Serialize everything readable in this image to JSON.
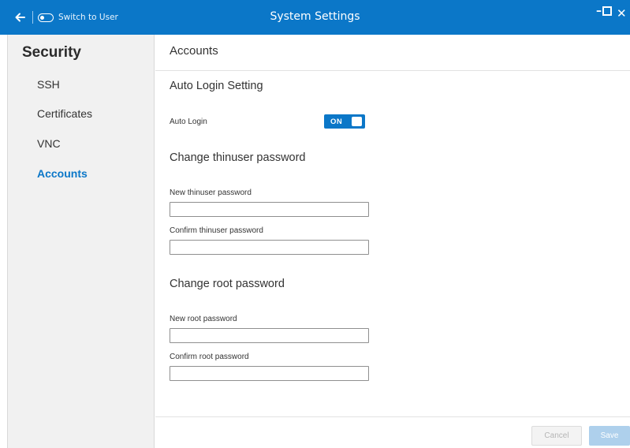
{
  "titlebar": {
    "back_icon": "arrow-left-icon",
    "switch_user_icon": "toggle-icon",
    "switch_user_label": "Switch to User",
    "title": "System Settings",
    "minimize_icon": "minimize-icon",
    "minimize_glyph": "–",
    "maximize_icon": "maximize-icon",
    "close_icon": "close-icon",
    "close_glyph": "✕",
    "bar_color": "#0b77c8"
  },
  "sidebar": {
    "title": "Security",
    "items": [
      {
        "label": "SSH",
        "active": false
      },
      {
        "label": "Certificates",
        "active": false
      },
      {
        "label": "VNC",
        "active": false
      },
      {
        "label": "Accounts",
        "active": true
      }
    ],
    "active_color": "#0b77c8"
  },
  "main": {
    "title": "Accounts",
    "auto_login": {
      "section_title": "Auto Login Setting",
      "label": "Auto Login",
      "toggle_text": "ON",
      "enabled": true
    },
    "thinuser": {
      "section_title": "Change thinuser password",
      "new_label": "New thinuser password",
      "new_value": "",
      "confirm_label": "Confirm thinuser password",
      "confirm_value": ""
    },
    "root": {
      "section_title": "Change root password",
      "new_label": "New root password",
      "new_value": "",
      "confirm_label": "Confirm root password",
      "confirm_value": ""
    },
    "buttons": {
      "cancel_label": "Cancel",
      "save_label": "Save",
      "cancel_enabled": false,
      "save_enabled": false
    }
  }
}
